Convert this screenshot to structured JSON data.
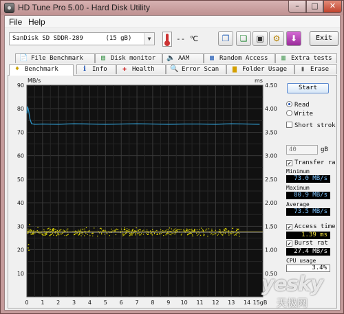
{
  "window": {
    "title": "HD Tune Pro 5.00 - Hard Disk Utility",
    "min": "–",
    "max": "□",
    "close": "✕"
  },
  "menu": {
    "file": "File",
    "help": "Help"
  },
  "toolbar": {
    "drive": "SanDisk SD SDDR-289      (15 gB)",
    "temperature": "-- ℃",
    "exit": "Exit",
    "icons": [
      "copy-info-icon",
      "copy-screenshot-icon",
      "save-icon",
      "options-icon",
      "download-icon"
    ]
  },
  "tabs_top": [
    {
      "label": "File Benchmark",
      "icon": "file-benchmark-icon"
    },
    {
      "label": "Disk monitor",
      "icon": "disk-monitor-icon"
    },
    {
      "label": "AAM",
      "icon": "speaker-icon"
    },
    {
      "label": "Random Access",
      "icon": "random-access-icon"
    },
    {
      "label": "Extra tests",
      "icon": "extra-tests-icon"
    }
  ],
  "tabs_bottom": [
    {
      "label": "Benchmark",
      "icon": "benchmark-icon"
    },
    {
      "label": "Info",
      "icon": "info-icon"
    },
    {
      "label": "Health",
      "icon": "health-icon"
    },
    {
      "label": "Error Scan",
      "icon": "error-scan-icon"
    },
    {
      "label": "Folder Usage",
      "icon": "folder-usage-icon"
    },
    {
      "label": "Erase",
      "icon": "erase-icon"
    }
  ],
  "side": {
    "start": "Start",
    "read": "Read",
    "write": "Write",
    "mode": "read",
    "short_stroke": "Short strok",
    "short_stroke_checked": false,
    "stroke_value": "40",
    "stroke_unit": "gB",
    "transfer_rate": "Transfer ra",
    "transfer_rate_checked": true,
    "minimum_label": "Minimum",
    "minimum_value": "73.0 MB/s",
    "maximum_label": "Maximum",
    "maximum_value": "80.9 MB/s",
    "average_label": "Average",
    "average_value": "73.5 MB/s",
    "access_time": "Access time",
    "access_time_checked": true,
    "access_time_value": "1.39 ms",
    "burst_rate": "Burst rat",
    "burst_rate_checked": true,
    "burst_rate_value": "27.4 MB/s",
    "cpu_usage_label": "CPU usage",
    "cpu_usage_value": "3.4%"
  },
  "chart_data": {
    "type": "line",
    "background": "#111111",
    "left_unit": "MB/s",
    "right_unit": "ms",
    "x_unit": "gB",
    "xlim": [
      0,
      15
    ],
    "ylim_left": [
      0,
      90
    ],
    "ylim_right": [
      0,
      4.5
    ],
    "x_ticks": [
      "0",
      "1",
      "2",
      "3",
      "4",
      "5",
      "6",
      "7",
      "8",
      "9",
      "10",
      "11",
      "12",
      "13",
      "14",
      "15gB"
    ],
    "y_ticks_left": [
      "90",
      "80",
      "70",
      "60",
      "50",
      "40",
      "30",
      "20",
      "10"
    ],
    "y_ticks_right": [
      "4.50",
      "4.00",
      "3.50",
      "3.00",
      "2.50",
      "2.00",
      "1.50",
      "1.00",
      "0.50"
    ],
    "series": [
      {
        "color": "#2f96c8",
        "x": [
          0,
          0.05,
          0.12,
          0.2,
          0.3,
          0.5,
          1,
          2,
          3,
          4,
          5,
          6,
          7,
          8,
          9,
          10,
          11,
          12,
          13,
          14,
          14.8
        ],
        "y": [
          78,
          80.9,
          79,
          75.5,
          73.6,
          73.4,
          73.5,
          73.4,
          73.6,
          73.5,
          73.4,
          73.5,
          73.6,
          73.5,
          73.4,
          73.5,
          73.5,
          73.4,
          73.6,
          73.5,
          73.4
        ]
      }
    ],
    "access_points": {
      "color": "#e8e000",
      "x_range": [
        0,
        13.5
      ],
      "ms_center": 1.39,
      "ms_spread": 0.09
    },
    "access_time_line_ms": 1.39,
    "burst_line_mbs": 27.4
  },
  "watermark": {
    "main": "yesky",
    "sub": "天极网"
  }
}
